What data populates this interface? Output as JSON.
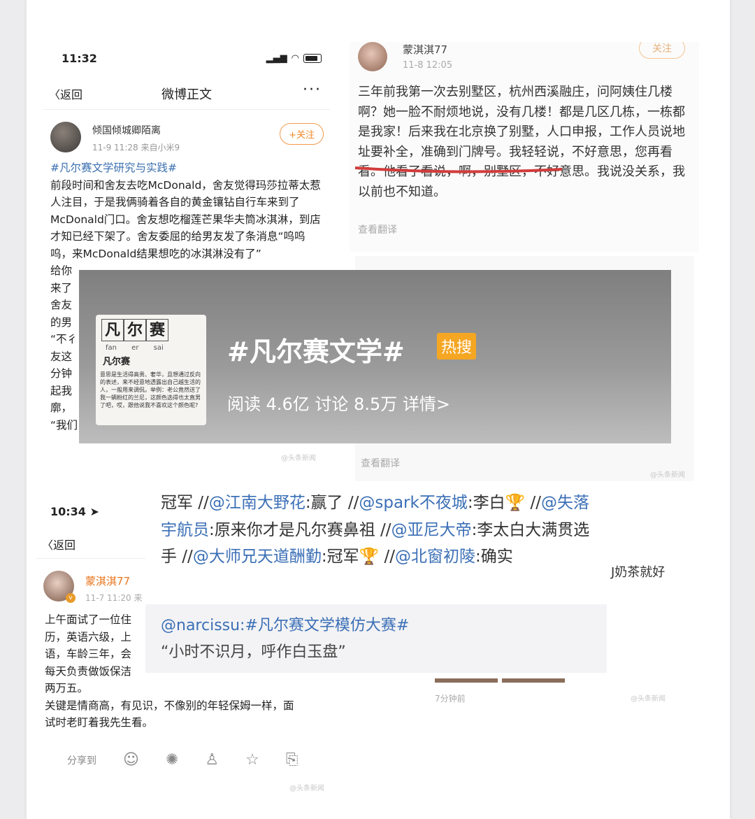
{
  "post1": {
    "status_time": "11:32",
    "nav_back": "返回",
    "nav_title": "微博正文",
    "nav_more": "···",
    "poster_name": "倾国倾城卿陌离",
    "post_meta": "11-9 11:28  来自小米9",
    "follow": "+关注",
    "hashtag": "#凡尔赛文学研究与实践#",
    "body": "前段时间和舍友去吃McDonald，舍友觉得玛莎拉蒂太惹人注目，于是我俩骑着各自的黄金镶钻自行车来到了McDonald门口。舍友想吃榴莲芒果华夫筒冰淇淋，到店才知已经下架了。舍友委屈的给男友发了条消息“呜呜呜，来McDonald结果想吃的冰淇淋没有了”",
    "body_fragments": [
      "给你",
      "来了",
      "舍友",
      "的男",
      "“不彳",
      "友这",
      "分钟",
      "起我",
      "廓，",
      "“我们"
    ]
  },
  "post2": {
    "name": "蒙淇淇77",
    "time": "11-8 12:05",
    "follow": "关注",
    "body": "三年前我第一次去别墅区，杭州西溪融庄，问阿姨住几楼啊？她一脸不耐烦地说，没有几楼！都是几区几栋，一栋都是我家！后来我在北京换了别墅，人口申报，工作人员说地址要补全，准确到门牌号。我轻轻说，不好意思，您再看看。他看了看说，啊，别墅区，不好意思。我说没关系，我以前也不知道。",
    "translate": "查看翻译",
    "translate2": "查看翻译"
  },
  "banner": {
    "card_chars": [
      "凡",
      "尔",
      "赛"
    ],
    "card_pinyin": "fan er sai",
    "card_word": "凡尔赛",
    "card_def": "意思是生活得高贵、奢华，且想通过反向的表述，来不经意地透露出自己越生活的人，一般用来调侃。举例：老公竟然送了我一辆粉红的兰尼，这颜色选得也太直男了吧，哎，跟他说我不喜欢这个颜色呢?",
    "title": "#凡尔赛文学#",
    "badge": "热搜",
    "stats": "阅读 4.6亿  讨论 8.5万  详情>"
  },
  "post3": {
    "status_time": "10:34",
    "nav_back": "返回",
    "name": "蒙淇淇77",
    "meta": "11-7 11:20  来",
    "body_lines": [
      "上午面试了一位住",
      "历，英语六级，上",
      "语，车龄三年，会",
      "每天负责做饭保洁",
      "两万五。",
      "关键是情商高，有见识，不像别的年轻保姆一样，面",
      "试时老盯着我先生看。"
    ],
    "share_label": "分享到",
    "share_icons": [
      "wechat-icon",
      "moments-icon",
      "qq-icon",
      "qzone-icon",
      "repost-icon"
    ]
  },
  "comments": {
    "parts": [
      {
        "t": "冠军 //",
        "at": false
      },
      {
        "t": "@江南大野花",
        "at": true
      },
      {
        "t": ":赢了 //",
        "at": false
      },
      {
        "t": "@spark不夜城",
        "at": true
      },
      {
        "t": ":李白🏆 //",
        "at": false
      },
      {
        "t": "@失落宇航员",
        "at": true
      },
      {
        "t": ":原来你才是凡尔赛鼻祖 //",
        "at": false
      },
      {
        "t": "@亚尼大帝",
        "at": true
      },
      {
        "t": ":李太白大满贯选手 //",
        "at": false
      },
      {
        "t": "@大师兄天道酬勤",
        "at": true
      },
      {
        "t": ":冠军🏆 //",
        "at": false
      },
      {
        "t": "@北窗初陵",
        "at": true
      },
      {
        "t": ":确实",
        "at": false
      }
    ],
    "quote_head": "@narcissu:#凡尔赛文学模仿大赛#",
    "quote_text": "“小时不识月，呼作白玉盘”"
  },
  "misc": {
    "tea_fragment": "J奶茶就好",
    "time_fragment": "7分钟前",
    "watermark": "@头条新闻"
  }
}
